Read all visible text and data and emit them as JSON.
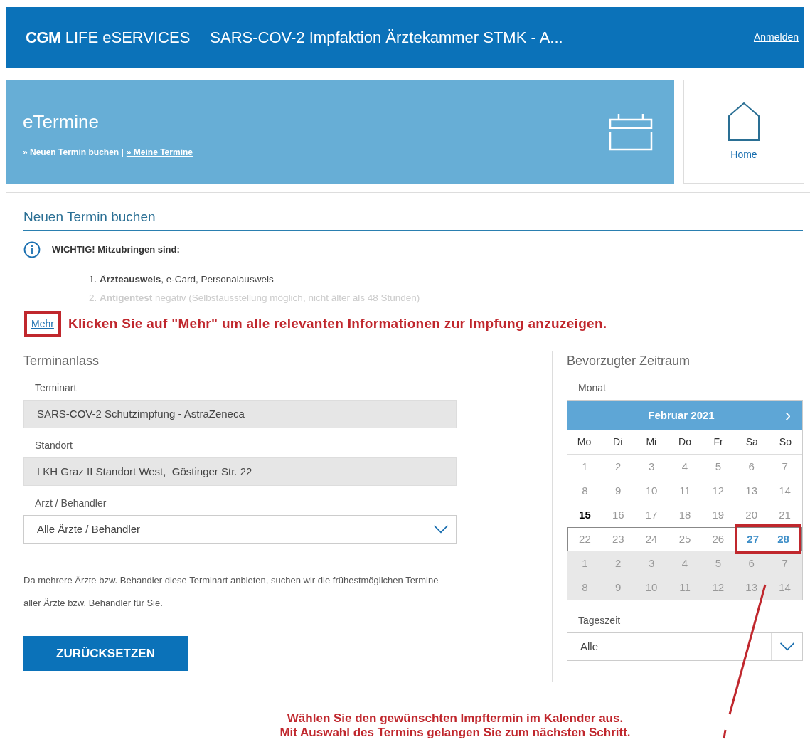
{
  "header": {
    "logo_bold": "CGM",
    "logo_rest": "LIFE eSERVICES",
    "title": "SARS-COV-2 Impfaktion Ärztekammer STMK - A...",
    "login": "Anmelden"
  },
  "banner": {
    "title": "eTermine",
    "links": [
      {
        "label": "» Neuen Termin buchen |",
        "selected": true
      },
      {
        "label": "» Meine Termine",
        "selected": false
      }
    ],
    "home": "Home"
  },
  "section_title": "Neuen Termin buchen",
  "info": {
    "heading": "WICHTIG! Mitzubringen sind:",
    "items": [
      {
        "text": "1. **Ärzteausweis**, e-Card, Personalausweis",
        "faded": false
      },
      {
        "text": "2. **Antigentest** negativ (Selbstausstellung möglich, nicht älter als 48 Stunden)",
        "faded": true
      }
    ],
    "more": "Mehr",
    "more_highlighted": true
  },
  "annotation_top": "Klicken Sie auf \"Mehr\" um alle relevanten Informationen zur Impfung anzuzeigen.",
  "left": {
    "heading": "Terminanlass",
    "fields": [
      {
        "kind": "readonly",
        "label": "Terminart",
        "value": "SARS-COV-2 Schutzimpfung - AstraZeneca"
      },
      {
        "kind": "readonly",
        "label": "Standort",
        "value": "LKH Graz II Standort West,  Göstinger Str. 22"
      },
      {
        "kind": "select",
        "label": "Arzt / Behandler",
        "value": "Alle Ärzte / Behandler"
      }
    ],
    "note": "Da mehrere Ärzte bzw. Behandler diese Terminart anbieten, suchen wir die frühestmöglichen Termine aller Ärzte bzw. Behandler für Sie.",
    "reset": "ZURÜCKSETZEN"
  },
  "right": {
    "heading": "Bevorzugter Zeitraum",
    "month_label": "Monat",
    "calendar": {
      "month": "Februar 2021",
      "next": "›",
      "weekdays": [
        "Mo",
        "Di",
        "Mi",
        "Do",
        "Fr",
        "Sa",
        "So"
      ],
      "weeks": [
        {
          "selected": false,
          "days": [
            {
              "label": "1",
              "kind": "past",
              "highlighted": false
            },
            {
              "label": "2",
              "kind": "past",
              "highlighted": false
            },
            {
              "label": "3",
              "kind": "past",
              "highlighted": false
            },
            {
              "label": "4",
              "kind": "past",
              "highlighted": false
            },
            {
              "label": "5",
              "kind": "past",
              "highlighted": false
            },
            {
              "label": "6",
              "kind": "past",
              "highlighted": false
            },
            {
              "label": "7",
              "kind": "past",
              "highlighted": false
            }
          ]
        },
        {
          "selected": false,
          "days": [
            {
              "label": "8",
              "kind": "past",
              "highlighted": false
            },
            {
              "label": "9",
              "kind": "past",
              "highlighted": false
            },
            {
              "label": "10",
              "kind": "past",
              "highlighted": false
            },
            {
              "label": "11",
              "kind": "past",
              "highlighted": false
            },
            {
              "label": "12",
              "kind": "past",
              "highlighted": false
            },
            {
              "label": "13",
              "kind": "past",
              "highlighted": false
            },
            {
              "label": "14",
              "kind": "past",
              "highlighted": false
            }
          ]
        },
        {
          "selected": false,
          "days": [
            {
              "label": "15",
              "kind": "today",
              "highlighted": false
            },
            {
              "label": "16",
              "kind": "past",
              "highlighted": false
            },
            {
              "label": "17",
              "kind": "past",
              "highlighted": false
            },
            {
              "label": "18",
              "kind": "past",
              "highlighted": false
            },
            {
              "label": "19",
              "kind": "past",
              "highlighted": false
            },
            {
              "label": "20",
              "kind": "past",
              "highlighted": false
            },
            {
              "label": "21",
              "kind": "past",
              "highlighted": false
            }
          ]
        },
        {
          "selected": true,
          "days": [
            {
              "label": "22",
              "kind": "past",
              "highlighted": false
            },
            {
              "label": "23",
              "kind": "past",
              "highlighted": false
            },
            {
              "label": "24",
              "kind": "past",
              "highlighted": false
            },
            {
              "label": "25",
              "kind": "past",
              "highlighted": false
            },
            {
              "label": "26",
              "kind": "past",
              "highlighted": false
            },
            {
              "label": "27",
              "kind": "available",
              "highlighted": true
            },
            {
              "label": "28",
              "kind": "available",
              "highlighted": true
            }
          ]
        },
        {
          "selected": false,
          "days": [
            {
              "label": "1",
              "kind": "other",
              "highlighted": false
            },
            {
              "label": "2",
              "kind": "other",
              "highlighted": false
            },
            {
              "label": "3",
              "kind": "other",
              "highlighted": false
            },
            {
              "label": "4",
              "kind": "other",
              "highlighted": false
            },
            {
              "label": "5",
              "kind": "other",
              "highlighted": false
            },
            {
              "label": "6",
              "kind": "other",
              "highlighted": false
            },
            {
              "label": "7",
              "kind": "other",
              "highlighted": false
            }
          ]
        },
        {
          "selected": false,
          "days": [
            {
              "label": "8",
              "kind": "other",
              "highlighted": false
            },
            {
              "label": "9",
              "kind": "other",
              "highlighted": false
            },
            {
              "label": "10",
              "kind": "other",
              "highlighted": false
            },
            {
              "label": "11",
              "kind": "other",
              "highlighted": false
            },
            {
              "label": "12",
              "kind": "other",
              "highlighted": false
            },
            {
              "label": "13",
              "kind": "other",
              "highlighted": false
            },
            {
              "label": "14",
              "kind": "other",
              "highlighted": false
            }
          ]
        }
      ]
    },
    "time_label": "Tageszeit",
    "time_value": "Alle"
  },
  "annotation_bottom": [
    "Wählen Sie den gewünschten Impftermin im Kalender aus.",
    "Mit Auswahl des Termins gelangen Sie zum nächsten Schritt."
  ]
}
